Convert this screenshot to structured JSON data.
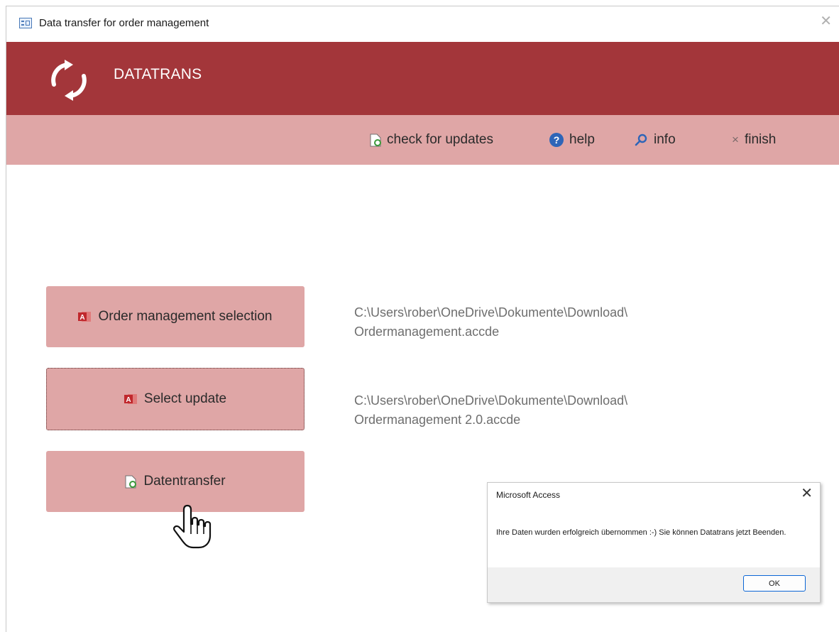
{
  "window": {
    "title": "Data transfer for order management",
    "close_glyph": "✕"
  },
  "banner": {
    "brand": "DATATRANS",
    "logo_icon": "refresh-icon"
  },
  "toolbar": {
    "items": [
      {
        "label": "check for updates",
        "icon": "document-refresh-icon"
      },
      {
        "label": "help",
        "icon": "help-icon"
      },
      {
        "label": "info",
        "icon": "search-icon"
      },
      {
        "label": "finish",
        "icon": "close-icon"
      }
    ],
    "help_glyph": "?",
    "finish_glyph": "×"
  },
  "actions": {
    "order_selection": {
      "label": "Order management selection",
      "path_line1": "C:\\Users\\rober\\OneDrive\\Dokumente\\Download\\",
      "path_line2": "Ordermanagement.accde"
    },
    "select_update": {
      "label": "Select update",
      "path_line1": "C:\\Users\\rober\\OneDrive\\Dokumente\\Download\\",
      "path_line2": "Ordermanagement 2.0.accde"
    },
    "datentransfer": {
      "label": "Datentransfer"
    }
  },
  "dialog": {
    "title": "Microsoft Access",
    "message": "Ihre Daten wurden erfolgreich übernommen :-) Sie können Datatrans jetzt Beenden.",
    "ok_label": "OK",
    "close_glyph": "✕"
  },
  "colors": {
    "banner": "#a3363a",
    "toolbar": "#dfa6a6",
    "button": "#dfa6a6",
    "access_red": "#c0282d",
    "help_blue": "#2e65b8"
  }
}
